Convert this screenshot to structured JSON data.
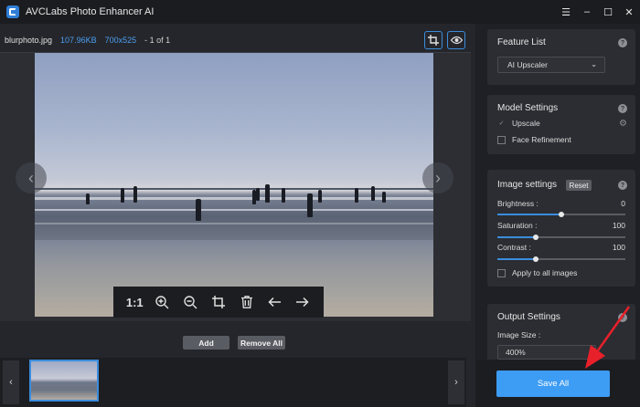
{
  "app": {
    "title": "AVCLabs Photo Enhancer AI"
  },
  "window_controls": {
    "menu": "☰",
    "minimize": "–",
    "maximize": "☐",
    "close": "✕"
  },
  "file_info": {
    "filename": "blurphoto.jpg",
    "filesize": "107.96KB",
    "dimensions": "700x525",
    "index": "- 1 of 1"
  },
  "preview_toolbar": {
    "zoom_reset": "1:1",
    "zoom_in": "zoom-in-icon",
    "zoom_out": "zoom-out-icon",
    "crop": "crop-icon",
    "delete": "trash-icon",
    "prev": "arrow-left-icon",
    "next": "arrow-right-icon"
  },
  "buttons": {
    "add": "Add",
    "remove_all": "Remove All",
    "save_all": "Save All"
  },
  "feature_list": {
    "title": "Feature List",
    "selected": "AI Upscaler"
  },
  "model_settings": {
    "title": "Model Settings",
    "options": [
      {
        "label": "Upscale",
        "checked": true
      },
      {
        "label": "Face Refinement",
        "checked": false
      }
    ]
  },
  "image_settings": {
    "title": "Image settings",
    "reset": "Reset",
    "sliders": [
      {
        "label": "Brightness :",
        "value": "0",
        "fraction": 0.5
      },
      {
        "label": "Saturation :",
        "value": "100",
        "fraction": 0.3
      },
      {
        "label": "Contrast :",
        "value": "100",
        "fraction": 0.3
      }
    ],
    "apply_all": "Apply to all images"
  },
  "output_settings": {
    "title": "Output Settings",
    "image_size_label": "Image Size :",
    "image_size_value": "400%"
  },
  "colors": {
    "accent": "#3d9cf3",
    "highlight": "#e8202a",
    "panel": "#2b2d32"
  }
}
